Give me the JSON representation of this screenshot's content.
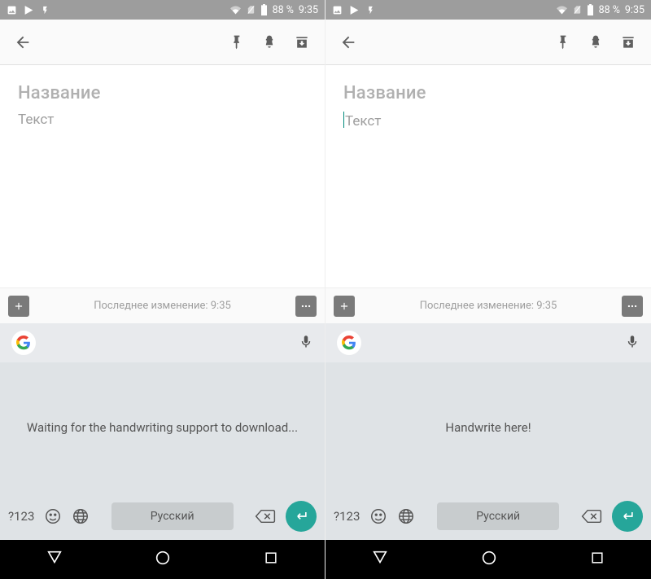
{
  "status": {
    "battery_text": "88 %",
    "time": "9:35"
  },
  "note": {
    "title_placeholder": "Название",
    "body_placeholder": "Текст"
  },
  "strip": {
    "last_edit": "Последнее изменение: 9:35"
  },
  "keyboard": {
    "symbols_label": "?123",
    "language_label": "Русский"
  },
  "handwriting": {
    "left_msg": "Waiting for the handwriting support to download...",
    "right_msg": "Handwrite here!"
  }
}
